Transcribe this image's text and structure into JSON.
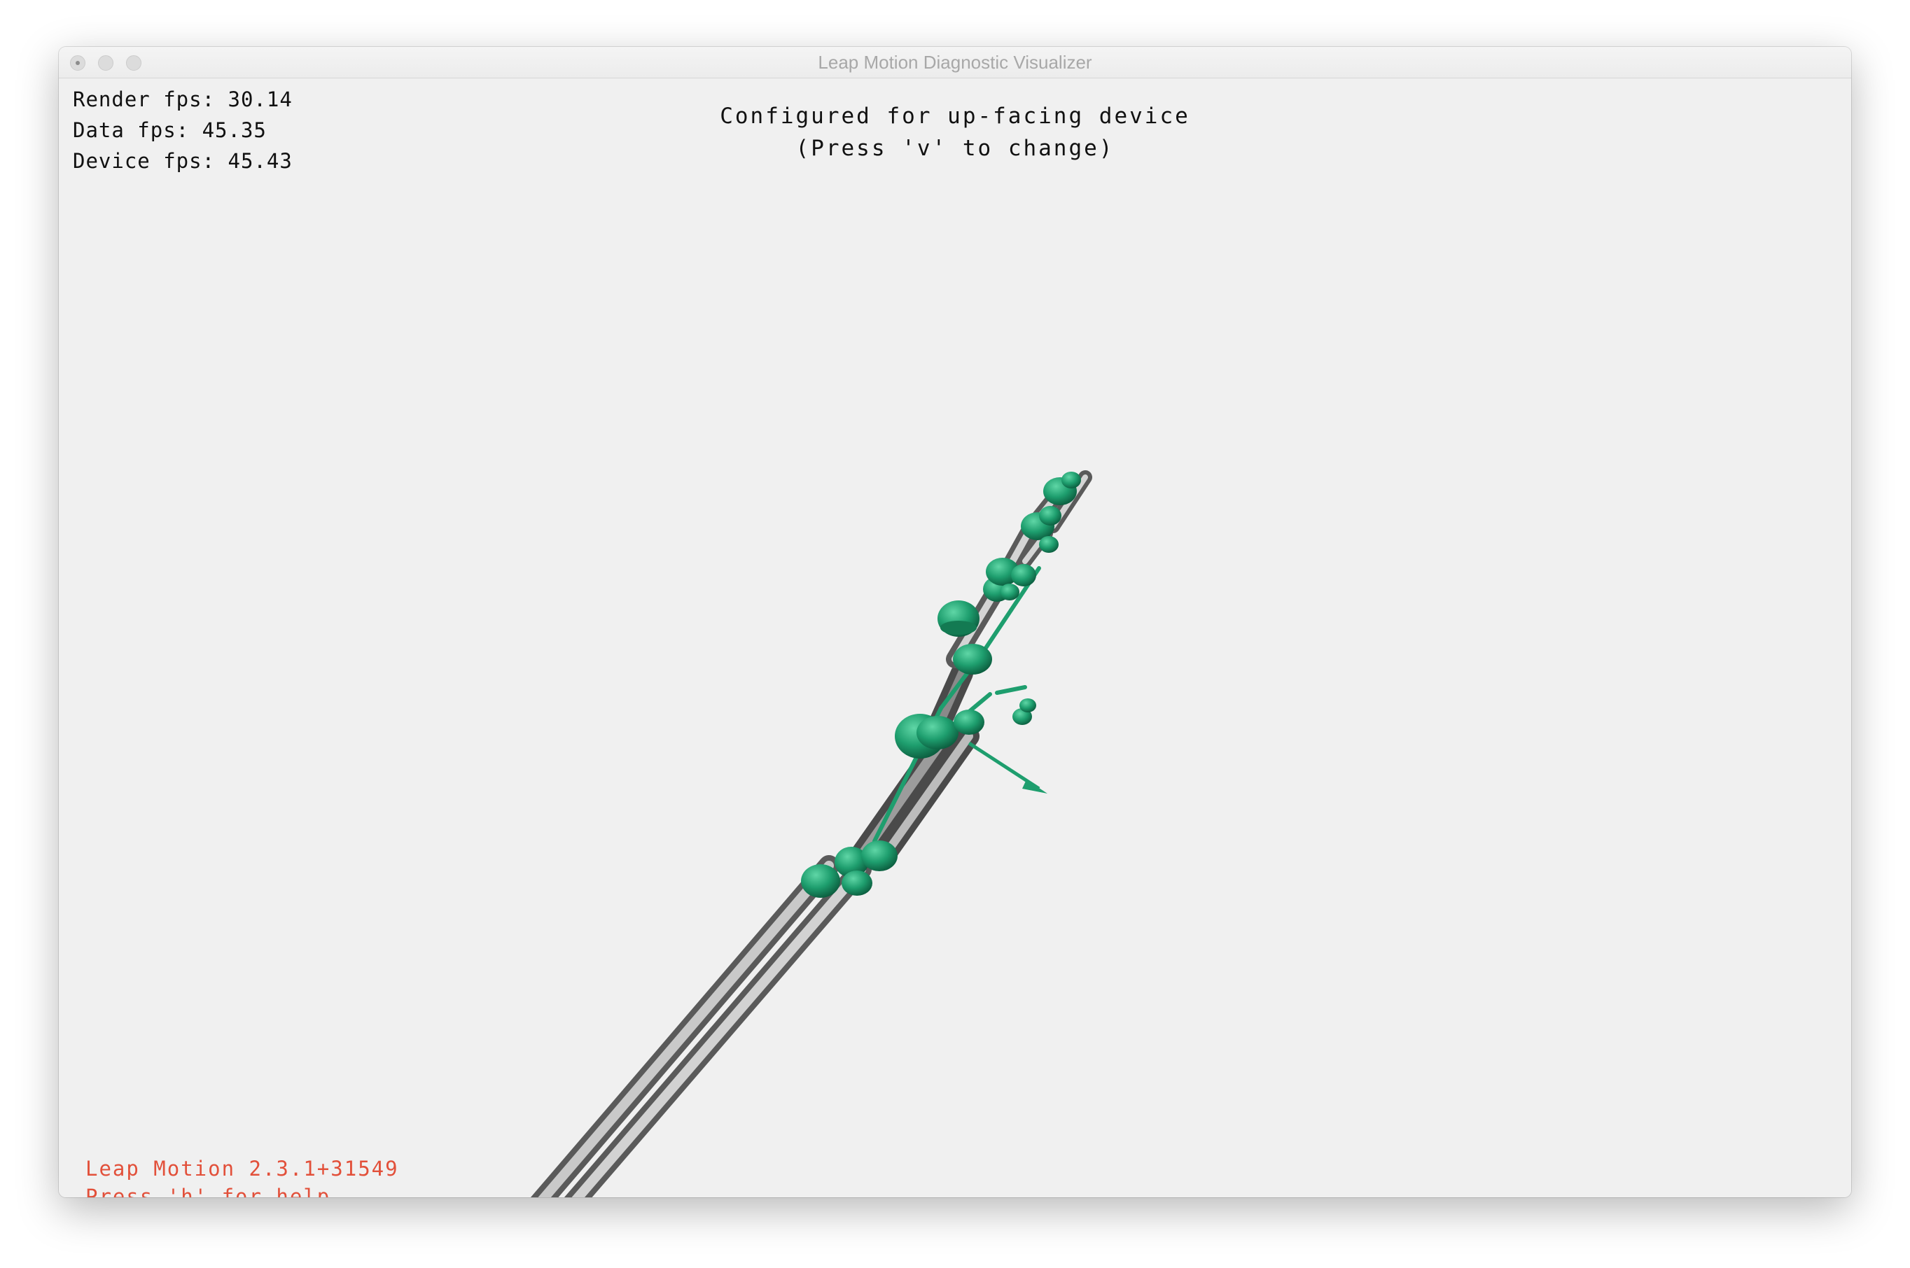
{
  "window": {
    "title": "Leap Motion Diagnostic Visualizer"
  },
  "stats": {
    "render": "Render fps: 30.14",
    "data": "Data fps: 45.35",
    "device": "Device fps: 45.43"
  },
  "config": {
    "line1": "Configured for up-facing device",
    "line2": "(Press 'v' to change)"
  },
  "footer": {
    "version": "Leap Motion 2.3.1+31549",
    "help": "Press 'h' for help"
  },
  "colors": {
    "background": "#f0f0f0",
    "joint": "#1e9e6e",
    "bone": "#9a9a9a",
    "version_text": "#e2503a"
  }
}
